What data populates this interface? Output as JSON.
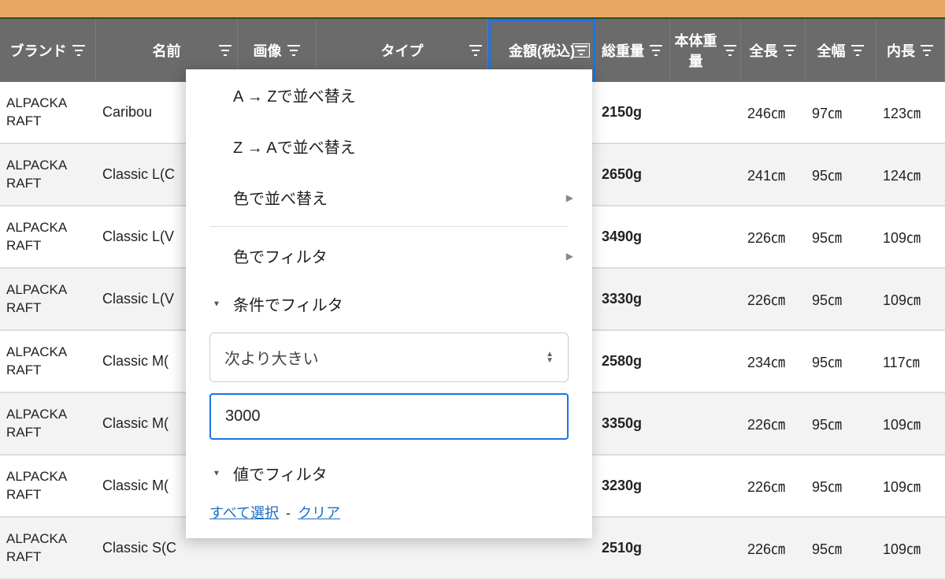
{
  "columns": {
    "brand": "ブランド",
    "name": "名前",
    "image": "画像",
    "type": "タイプ",
    "price": "金額(税込)",
    "total_weight": "総重量",
    "body_weight": "本体重量",
    "total_length": "全長",
    "total_width": "全幅",
    "inner_length": "内長"
  },
  "rows": [
    {
      "brand": "ALPACKA\nRAFT",
      "name": "Caribou",
      "total_weight": "2150g",
      "total_length": "246㎝",
      "total_width": "97㎝",
      "inner_length": "123㎝"
    },
    {
      "brand": "ALPACKA\nRAFT",
      "name": "Classic L(C",
      "total_weight": "2650g",
      "total_length": "241㎝",
      "total_width": "95㎝",
      "inner_length": "124㎝"
    },
    {
      "brand": "ALPACKA\nRAFT",
      "name": "Classic L(V",
      "total_weight": "3490g",
      "total_length": "226㎝",
      "total_width": "95㎝",
      "inner_length": "109㎝"
    },
    {
      "brand": "ALPACKA\nRAFT",
      "name": "Classic L(V",
      "total_weight": "3330g",
      "total_length": "226㎝",
      "total_width": "95㎝",
      "inner_length": "109㎝"
    },
    {
      "brand": "ALPACKA\nRAFT",
      "name": "Classic M(",
      "total_weight": "2580g",
      "total_length": "234㎝",
      "total_width": "95㎝",
      "inner_length": "117㎝"
    },
    {
      "brand": "ALPACKA\nRAFT",
      "name": "Classic M(",
      "total_weight": "3350g",
      "total_length": "226㎝",
      "total_width": "95㎝",
      "inner_length": "109㎝"
    },
    {
      "brand": "ALPACKA\nRAFT",
      "name": "Classic M(",
      "total_weight": "3230g",
      "total_length": "226㎝",
      "total_width": "95㎝",
      "inner_length": "109㎝"
    },
    {
      "brand": "ALPACKA\nRAFT",
      "name": "Classic S(C",
      "total_weight": "2510g",
      "total_length": "226㎝",
      "total_width": "95㎝",
      "inner_length": "109㎝"
    }
  ],
  "filter_menu": {
    "sort_az": "A → Zで並べ替え",
    "sort_za": "Z → Aで並べ替え",
    "sort_color": "色で並べ替え",
    "filter_color": "色でフィルタ",
    "filter_condition": "条件でフィルタ",
    "condition_option": "次より大きい",
    "condition_value": "3000",
    "filter_value": "値でフィルタ",
    "select_all": "すべて選択",
    "separator": "-",
    "clear": "クリア"
  }
}
